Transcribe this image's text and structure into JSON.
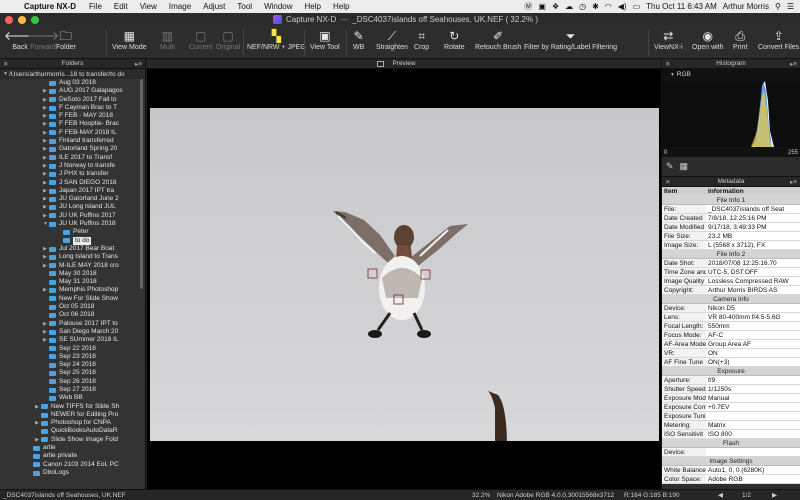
{
  "menubar": {
    "app_name": "Capture NX-D",
    "items": [
      "File",
      "Edit",
      "View",
      "Image",
      "Adjust",
      "Tool",
      "Window",
      "Help",
      "Help"
    ],
    "clock": "Thu Oct 11  6:43 AM",
    "user": "Arthur Morris"
  },
  "window": {
    "app_title": "Capture NX-D",
    "doc_title": "_DSC4037islands off Seahouses, UK.NEF ( 32.2% )"
  },
  "toolbar": {
    "back": "Back",
    "forward": "Forward",
    "folder": "Folder",
    "view_mode": "View Mode",
    "multi": "Multi",
    "current": "Current",
    "original": "Original",
    "nef_jpeg": "NEF/NRW + JPEG",
    "view_tool": "View Tool",
    "wb": "WB",
    "straighten": "Straighten",
    "crop": "Crop",
    "rotate": "Rotate",
    "retouch": "Retouch Brush",
    "filter": "Filter by Rating/Label Filtering",
    "viewnx": "ViewNX-i",
    "open_with": "Open with",
    "print": "Print",
    "convert": "Convert Files"
  },
  "left_panel": {
    "title": "Folders",
    "path": "/Users/arthurmorris...18 to transfer/to do",
    "items": [
      {
        "label": "Aug 03 2018",
        "arrow": ""
      },
      {
        "label": "AUG 2017 Galapagos",
        "arrow": "▶"
      },
      {
        "label": "DeSoto 2017 Fall to",
        "arrow": "▶"
      },
      {
        "label": "F Cayman Brac to T",
        "arrow": "▶"
      },
      {
        "label": "F FEB - MAY 2018",
        "arrow": "▶"
      },
      {
        "label": "F FEB Hooptie- Brac",
        "arrow": "▶"
      },
      {
        "label": "F FEB-MAY 2018 IL",
        "arrow": "▶"
      },
      {
        "label": "Finland transferred",
        "arrow": "▶"
      },
      {
        "label": "Gatorland Spring 20",
        "arrow": "▶"
      },
      {
        "label": "ILE  2017 to Transf",
        "arrow": "▶"
      },
      {
        "label": "J Norway to transfe",
        "arrow": "▶"
      },
      {
        "label": "J PHX to transfer",
        "arrow": "▶"
      },
      {
        "label": "J SAN DIEGO 2018",
        "arrow": "▶"
      },
      {
        "label": "Japan 2017 IPT tra",
        "arrow": "▶"
      },
      {
        "label": "JU Gatorland June 2",
        "arrow": "▶"
      },
      {
        "label": "JU Long Island JUL",
        "arrow": "▶"
      },
      {
        "label": "JU UK Puffins 2017",
        "arrow": "▶"
      },
      {
        "label": "JU UK Puffins 2018",
        "arrow": "▼"
      },
      {
        "label": "Peter",
        "arrow": "",
        "indent": 1
      },
      {
        "label": "to do",
        "arrow": "",
        "indent": 1,
        "selected": true
      },
      {
        "label": "Jul 2017 Bear Boat",
        "arrow": "▶"
      },
      {
        "label": "Long Island to Trans",
        "arrow": "▶"
      },
      {
        "label": "M-ILE MAY 2018 cro",
        "arrow": "▶"
      },
      {
        "label": "May 30 2018",
        "arrow": ""
      },
      {
        "label": "May 31 2018",
        "arrow": ""
      },
      {
        "label": "Memphis Photoshop",
        "arrow": "▶"
      },
      {
        "label": "New For Slide Show",
        "arrow": ""
      },
      {
        "label": "Oct 05 2018",
        "arrow": ""
      },
      {
        "label": "Oct 06 2018",
        "arrow": ""
      },
      {
        "label": "Palouse 2017 IPT to",
        "arrow": "▶"
      },
      {
        "label": "San Diego March 20",
        "arrow": "▶"
      },
      {
        "label": "SE SUmmer 2018 IL",
        "arrow": "▶"
      },
      {
        "label": "Sep 22 2018",
        "arrow": ""
      },
      {
        "label": "Sep 23 2018",
        "arrow": ""
      },
      {
        "label": "Sep 24 2018",
        "arrow": ""
      },
      {
        "label": "Sep 25 2018",
        "arrow": ""
      },
      {
        "label": "Sep 26 2018",
        "arrow": ""
      },
      {
        "label": "Sep 27 2018",
        "arrow": ""
      },
      {
        "label": "Web BB",
        "arrow": ""
      },
      {
        "label": "New TIFFS for Slide Sh",
        "arrow": "▶",
        "outdent": true
      },
      {
        "label": "NEWER for Editing Pro",
        "arrow": "",
        "outdent": true
      },
      {
        "label": "Photoshop for CNPA",
        "arrow": "▶",
        "outdent": true
      },
      {
        "label": "QuickBooksAutoDataR",
        "arrow": "",
        "outdent": true
      },
      {
        "label": "Slide Show Image Fold",
        "arrow": "▶",
        "outdent": true
      },
      {
        "label": "artie",
        "arrow": "",
        "outdent2": true
      },
      {
        "label": "artie private",
        "arrow": "",
        "outdent2": true
      },
      {
        "label": "Canon 2103 2014 EoL PC",
        "arrow": "",
        "outdent2": true
      },
      {
        "label": "DboLogs",
        "arrow": "",
        "outdent2": true
      }
    ]
  },
  "center": {
    "title": "Preview"
  },
  "histogram": {
    "title": "Histogram",
    "channel": "RGB",
    "min": "0",
    "max": "255"
  },
  "metadata": {
    "title": "Metadata",
    "col_item": "Item",
    "col_info": "Information",
    "rows": [
      {
        "section": "File Info 1"
      },
      {
        "k": "File:",
        "v": "_DSC4037islands off Seat"
      },
      {
        "k": "Date Created",
        "v": "7/8/18, 12:25:16 PM"
      },
      {
        "k": "Date Modified",
        "v": "9/17/18, 3:49:33 PM"
      },
      {
        "k": "File Size:",
        "v": "23.2 MB"
      },
      {
        "k": "Image Size:",
        "v": "L (5568 x 3712), FX"
      },
      {
        "section": "File Info 2"
      },
      {
        "k": "Date Shot:",
        "v": "2018/07/08 12:25:16.70"
      },
      {
        "k": "Time Zone and",
        "v": "UTC-5, DST:OFF"
      },
      {
        "k": "Image Quality",
        "v": "Lossless Compressed RAW"
      },
      {
        "k": "Copyright:",
        "v": "Arthur Morris    BIRDS AS"
      },
      {
        "section": "Camera Info"
      },
      {
        "k": "Device:",
        "v": "Nikon D5"
      },
      {
        "k": "Lens:",
        "v": "VR 80-400mm f/4.5-5.6G"
      },
      {
        "k": "Focal Length:",
        "v": "550mm"
      },
      {
        "k": "Focus Mode:",
        "v": "AF-C"
      },
      {
        "k": "AF-Area Mode",
        "v": "Group Area AF"
      },
      {
        "k": "VR:",
        "v": "ON"
      },
      {
        "k": "AF Fine Tune",
        "v": "ON(+3)"
      },
      {
        "section": "Exposure"
      },
      {
        "k": "Aperture:",
        "v": "f/9"
      },
      {
        "k": "Shutter Speed",
        "v": "1/1250s"
      },
      {
        "k": "Exposure Mode",
        "v": "Manual"
      },
      {
        "k": "Exposure Comp",
        "v": "+0.7EV"
      },
      {
        "k": "Exposure Tuni",
        "v": ""
      },
      {
        "k": "Metering:",
        "v": "Matrix"
      },
      {
        "k": "ISO Sensitivit",
        "v": "ISO 800"
      },
      {
        "section": "Flash"
      },
      {
        "k": "Device:",
        "v": ""
      },
      {
        "section": "Image Settings"
      },
      {
        "k": "White Balance",
        "v": "Auto1, 0, 0 (6280K)"
      },
      {
        "k": "Color Space:",
        "v": "Adobe RGB"
      }
    ]
  },
  "statusbar": {
    "filename": "_DSC4037islands off Seahouses, UK.NEF",
    "zoom": "32.2%",
    "profile": "Nikon Adobe RGB 4.0.0.3001",
    "dims": "5568x3712",
    "rgb": "R:184 G:185 B:190",
    "page": "1/2"
  }
}
